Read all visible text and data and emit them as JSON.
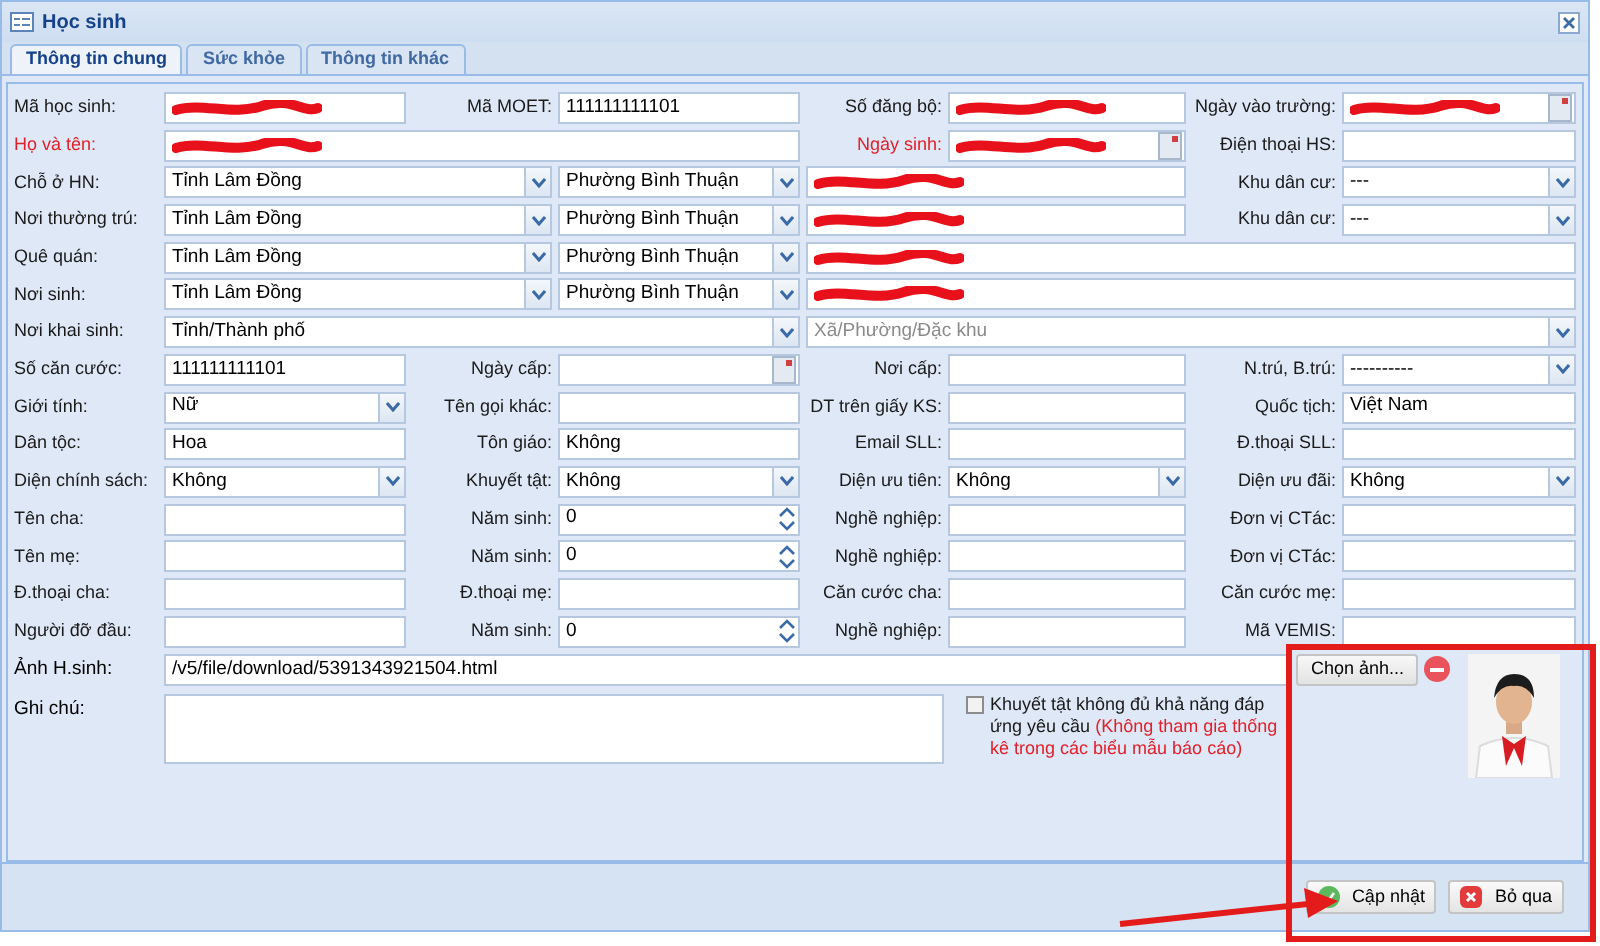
{
  "window": {
    "title": "Học sinh"
  },
  "tabs": [
    {
      "label": "Thông tin chung",
      "selected": true
    },
    {
      "label": "Sức khỏe",
      "selected": false
    },
    {
      "label": "Thông tin khác",
      "selected": false
    }
  ],
  "rows": [
    {
      "kind": "standard",
      "cells": [
        {
          "kind": "label",
          "text": "Mã học sinh:",
          "required": false
        },
        {
          "kind": "text",
          "redacted": true
        },
        {
          "kind": "label",
          "text": "Mã MOET:",
          "required": false
        },
        {
          "kind": "text",
          "value": "111111111101"
        },
        {
          "kind": "label",
          "text": "Số đăng bộ:",
          "required": false
        },
        {
          "kind": "text",
          "redacted": true
        },
        {
          "kind": "label",
          "text": "Ngày vào trường:",
          "required": false
        },
        {
          "kind": "date",
          "redacted": true
        }
      ]
    },
    {
      "kind": "wide_name",
      "cells": [
        {
          "kind": "label",
          "text": "Họ và tên:",
          "required": true
        },
        {
          "kind": "text",
          "redacted": true
        },
        {
          "kind": "label",
          "text": "Ngày sinh:",
          "required": true
        },
        {
          "kind": "date",
          "redacted": true
        },
        {
          "kind": "label",
          "text": "Điện thoại HS:",
          "required": false
        },
        {
          "kind": "text"
        }
      ]
    },
    {
      "kind": "address_area",
      "cells": [
        {
          "kind": "label",
          "text": "Chỗ ở HN:",
          "required": false
        },
        {
          "kind": "select",
          "value": "Tỉnh Lâm Đồng"
        },
        {
          "kind": "select",
          "value": "Phường Bình Thuận"
        },
        {
          "kind": "text",
          "redacted": true
        },
        {
          "kind": "label",
          "text": "Khu dân cư:",
          "required": false
        },
        {
          "kind": "select",
          "value": "---"
        }
      ]
    },
    {
      "kind": "address_area",
      "cells": [
        {
          "kind": "label",
          "text": "Nơi thường trú:",
          "required": false
        },
        {
          "kind": "select",
          "value": "Tỉnh Lâm Đồng"
        },
        {
          "kind": "select",
          "value": "Phường Bình Thuận"
        },
        {
          "kind": "text",
          "redacted": true
        },
        {
          "kind": "label",
          "text": "Khu dân cư:",
          "required": false
        },
        {
          "kind": "select",
          "value": "---"
        }
      ]
    },
    {
      "kind": "address",
      "cells": [
        {
          "kind": "label",
          "text": "Quê quán:",
          "required": false
        },
        {
          "kind": "select",
          "value": "Tỉnh Lâm Đồng"
        },
        {
          "kind": "select",
          "value": "Phường Bình Thuận"
        },
        {
          "kind": "text",
          "redacted": true
        }
      ]
    },
    {
      "kind": "address",
      "cells": [
        {
          "kind": "label",
          "text": "Nơi sinh:",
          "required": false
        },
        {
          "kind": "select",
          "value": "Tỉnh Lâm Đồng"
        },
        {
          "kind": "select",
          "value": "Phường Bình Thuận"
        },
        {
          "kind": "text",
          "redacted": true
        }
      ]
    },
    {
      "kind": "two_selects",
      "cells": [
        {
          "kind": "label",
          "text": "Nơi khai sinh:",
          "required": false
        },
        {
          "kind": "select",
          "value": "Tỉnh/Thành phố"
        },
        {
          "kind": "select",
          "placeholder": "Xã/Phường/Đặc khu"
        }
      ]
    },
    {
      "kind": "standard",
      "cells": [
        {
          "kind": "label",
          "text": "Số căn cước:",
          "required": false
        },
        {
          "kind": "text",
          "value": "111111111101"
        },
        {
          "kind": "label",
          "text": "Ngày cấp:",
          "required": false
        },
        {
          "kind": "date"
        },
        {
          "kind": "label",
          "text": "Nơi cấp:",
          "required": false
        },
        {
          "kind": "text"
        },
        {
          "kind": "label",
          "text": "N.trú, B.trú:",
          "required": false
        },
        {
          "kind": "select",
          "value": "----------"
        }
      ]
    },
    {
      "kind": "standard",
      "cells": [
        {
          "kind": "label",
          "text": "Giới tính:",
          "required": false
        },
        {
          "kind": "select",
          "value": "Nữ"
        },
        {
          "kind": "label",
          "text": "Tên gọi khác:",
          "required": false
        },
        {
          "kind": "text"
        },
        {
          "kind": "label",
          "text": "DT trên giấy KS:",
          "required": false
        },
        {
          "kind": "text"
        },
        {
          "kind": "label",
          "text": "Quốc tịch:",
          "required": false
        },
        {
          "kind": "text",
          "value": "Việt Nam"
        }
      ]
    },
    {
      "kind": "standard",
      "cells": [
        {
          "kind": "label",
          "text": "Dân tộc:",
          "required": false
        },
        {
          "kind": "text",
          "value": "Hoa"
        },
        {
          "kind": "label",
          "text": "Tôn giáo:",
          "required": false
        },
        {
          "kind": "text",
          "value": "Không"
        },
        {
          "kind": "label",
          "text": "Email SLL:",
          "required": false
        },
        {
          "kind": "text"
        },
        {
          "kind": "label",
          "text": "Đ.thoại SLL:",
          "required": false
        },
        {
          "kind": "text"
        }
      ]
    },
    {
      "kind": "standard",
      "cells": [
        {
          "kind": "label",
          "text": "Diện chính sách:",
          "required": false
        },
        {
          "kind": "select",
          "value": "Không"
        },
        {
          "kind": "label",
          "text": "Khuyết tật:",
          "required": false
        },
        {
          "kind": "select",
          "value": "Không"
        },
        {
          "kind": "label",
          "text": "Diện ưu tiên:",
          "required": false
        },
        {
          "kind": "select",
          "value": "Không"
        },
        {
          "kind": "label",
          "text": "Diện ưu đãi:",
          "required": false
        },
        {
          "kind": "select",
          "value": "Không"
        }
      ]
    },
    {
      "kind": "standard",
      "cells": [
        {
          "kind": "label",
          "text": "Tên cha:",
          "required": false
        },
        {
          "kind": "text"
        },
        {
          "kind": "label",
          "text": "Năm sinh:",
          "required": false
        },
        {
          "kind": "number",
          "value": "0"
        },
        {
          "kind": "label",
          "text": "Nghề nghiệp:",
          "required": false
        },
        {
          "kind": "text"
        },
        {
          "kind": "label",
          "text": "Đơn vị CTác:",
          "required": false
        },
        {
          "kind": "text"
        }
      ]
    },
    {
      "kind": "standard",
      "cells": [
        {
          "kind": "label",
          "text": "Tên mẹ:",
          "required": false
        },
        {
          "kind": "text"
        },
        {
          "kind": "label",
          "text": "Năm sinh:",
          "required": false
        },
        {
          "kind": "number",
          "value": "0"
        },
        {
          "kind": "label",
          "text": "Nghề nghiệp:",
          "required": false
        },
        {
          "kind": "text"
        },
        {
          "kind": "label",
          "text": "Đơn vị CTác:",
          "required": false
        },
        {
          "kind": "text"
        }
      ]
    },
    {
      "kind": "standard",
      "cells": [
        {
          "kind": "label",
          "text": "Đ.thoại cha:",
          "required": false
        },
        {
          "kind": "text"
        },
        {
          "kind": "label",
          "text": "Đ.thoại mẹ:",
          "required": false
        },
        {
          "kind": "text"
        },
        {
          "kind": "label",
          "text": "Căn cước cha:",
          "required": false
        },
        {
          "kind": "text"
        },
        {
          "kind": "label",
          "text": "Căn cước mẹ:",
          "required": false
        },
        {
          "kind": "text"
        }
      ]
    },
    {
      "kind": "standard",
      "cells": [
        {
          "kind": "label",
          "text": "Người đỡ đầu:",
          "required": false
        },
        {
          "kind": "text"
        },
        {
          "kind": "label",
          "text": "Năm sinh:",
          "required": false
        },
        {
          "kind": "number",
          "value": "0"
        },
        {
          "kind": "label",
          "text": "Nghề nghiệp:",
          "required": false
        },
        {
          "kind": "text"
        },
        {
          "kind": "label",
          "text": "Mã VEMIS:",
          "required": false
        },
        {
          "kind": "text"
        }
      ]
    }
  ],
  "photo": {
    "label": "Ảnh H.sinh:",
    "value": "/v5/file/download/5391343921504.html",
    "choose_button": "Chọn ảnh..."
  },
  "note": {
    "label": "Ghi chú:"
  },
  "disability_checkbox": {
    "checked": false,
    "text": "Khuyết tật không đủ khả năng đáp ứng yêu cầu",
    "hint": "(Không tham gia thống kê trong các biểu mẫu báo cáo)"
  },
  "buttons": [
    {
      "kind": "save",
      "label": "Cập nhật"
    },
    {
      "kind": "cancel",
      "label": "Bỏ qua"
    }
  ]
}
